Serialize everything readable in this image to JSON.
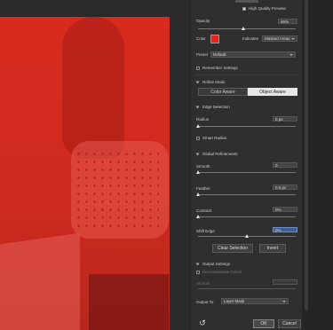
{
  "view": {
    "high_quality_preview_label": "High Quality Preview",
    "high_quality_preview_checked": true,
    "opacity_label": "Opacity",
    "opacity_value": "46%",
    "color_label": "Color",
    "color_hex": "#e8231f",
    "indicates_label": "Indicates",
    "indicates_value": "Masked Areas",
    "preset_label": "Preset",
    "preset_value": "Default",
    "remember_settings_label": "Remember Settings"
  },
  "refine_mode": {
    "title": "Refine Mode",
    "options": [
      "Color Aware",
      "Object Aware"
    ],
    "selected": "Object Aware"
  },
  "edge_detection": {
    "title": "Edge Detection",
    "radius_label": "Radius",
    "radius_value": "0 px",
    "smart_radius_label": "Smart Radius"
  },
  "global_refinements": {
    "title": "Global Refinements",
    "smooth_label": "Smooth",
    "smooth_value": "0",
    "feather_label": "Feather",
    "feather_value": "0.0 px",
    "contrast_label": "Contrast",
    "contrast_value": "0%",
    "shift_edge_label": "Shift Edge",
    "shift_edge_value": "0%"
  },
  "actions": {
    "clear_selection_label": "Clear Selection",
    "invert_label": "Invert"
  },
  "output_settings": {
    "title": "Output Settings",
    "decontaminate_label": "Decontaminate Colors",
    "amount_label": "Amount",
    "output_to_label": "Output To",
    "output_to_value": "Layer Mask"
  },
  "footer": {
    "reset_icon": "reset-icon",
    "ok_label": "OK",
    "cancel_label": "Cancel"
  }
}
